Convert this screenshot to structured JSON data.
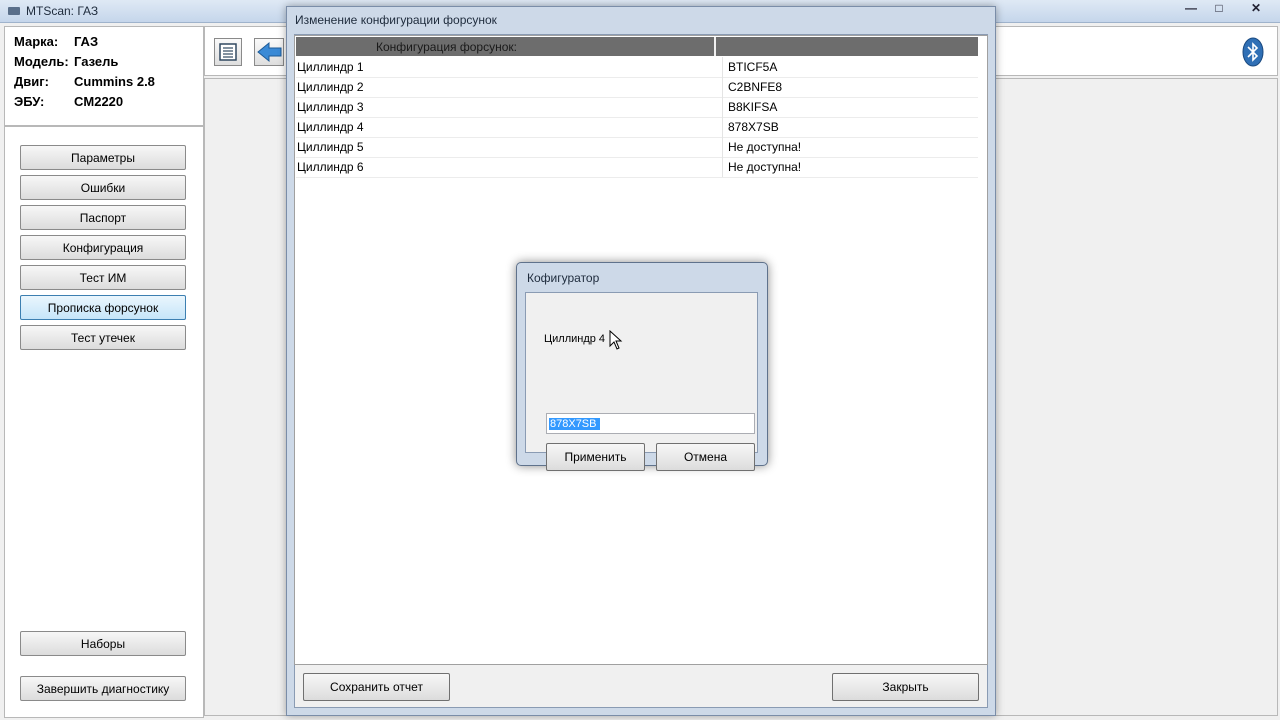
{
  "app": {
    "title": "MTScan: ГАЗ"
  },
  "window_controls": {
    "minimize": "—",
    "maximize": "□",
    "close": "✕"
  },
  "vehicle_info": [
    {
      "label": "Марка:",
      "value": "ГАЗ"
    },
    {
      "label": "Модель:",
      "value": "Газель"
    },
    {
      "label": "Двиг:",
      "value": "Cummins 2.8"
    },
    {
      "label": "ЭБУ:",
      "value": "CM2220"
    }
  ],
  "menu": {
    "items": [
      "Параметры",
      "Ошибки",
      "Паспорт",
      "Конфигурация",
      "Тест ИМ",
      "Прописка форсунок",
      "Тест утечек"
    ],
    "active": "Прописка форсунок",
    "presets": "Наборы",
    "finish": "Завершить диагностику"
  },
  "toolbar": {
    "icons": [
      "list-icon",
      "back-arrow-icon",
      "bluetooth-icon"
    ]
  },
  "config_dialog": {
    "title": "Изменение конфигурации форсунок",
    "column_header": "Конфигурация форсунок:",
    "rows": [
      {
        "cylinder": "Циллиндр 1",
        "code": "BTICF5A"
      },
      {
        "cylinder": "Циллиндр 2",
        "code": "C2BNFE8"
      },
      {
        "cylinder": "Циллиндр 3",
        "code": "B8KIFSA"
      },
      {
        "cylinder": "Циллиндр 4",
        "code": "878X7SB"
      },
      {
        "cylinder": "Циллиндр 5",
        "code": "Не доступна!"
      },
      {
        "cylinder": "Циллиндр 6",
        "code": "Не доступна!"
      }
    ],
    "save_report": "Сохранить отчет",
    "close": "Закрыть"
  },
  "configurator_dialog": {
    "title": "Кофигуратор",
    "label": "Циллиндр 4",
    "input_value": "878X7SB",
    "apply": "Применить",
    "cancel": "Отмена"
  },
  "colors": {
    "accent": "#3399ff",
    "grid_header": "#6d6d6d",
    "title_bar": "#cdd9e8"
  }
}
